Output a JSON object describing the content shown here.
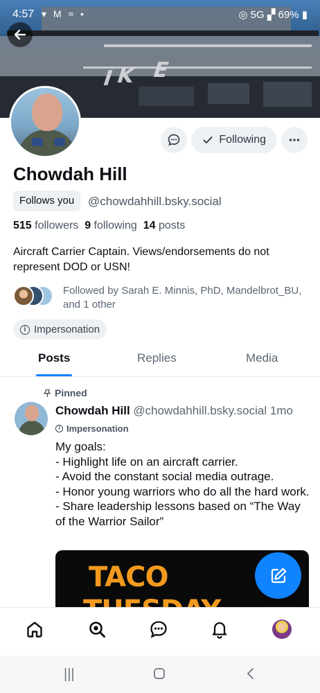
{
  "status_bar": {
    "time": "4:57",
    "left_icons": "▾ M ≈ •",
    "network": "5G",
    "battery": "69%"
  },
  "banner": {
    "letters": [
      "I",
      "K",
      "E"
    ]
  },
  "profile": {
    "display_name": "Chowdah Hill",
    "follows_you": "Follows you",
    "handle": "@chowdahhill.bsky.social",
    "followers_count": "515",
    "followers_label": "followers",
    "following_count": "9",
    "following_label": "following",
    "posts_count": "14",
    "posts_label": "posts",
    "bio": "Aircraft Carrier Captain. Views/endorsements do not represent DOD or USN!",
    "followed_by": "Followed by Sarah E. Minnis, PhD, Mandelbrot_BU, and 1 other",
    "label": "Impersonation"
  },
  "actions": {
    "following_label": "Following"
  },
  "tabs": [
    {
      "label": "Posts",
      "active": true
    },
    {
      "label": "Replies",
      "active": false
    },
    {
      "label": "Media",
      "active": false
    }
  ],
  "post": {
    "pinned_label": "Pinned",
    "author_name": "Chowdah Hill",
    "author_handle": "@chowdahhill.bsky.social",
    "age": "1mo",
    "label": "Impersonation",
    "text": "My goals:\n- Highlight life on an aircraft carrier.\n- Avoid the constant social media outrage.\n- Honor young warriors who do all the hard work.\n- Share leadership lessons based on “The Way of the Warrior Sailor”",
    "image_line1": "TACO",
    "image_line2": "TUESDAY"
  },
  "bottom_nav": [
    "home-icon",
    "search-icon",
    "chat-icon",
    "bell-icon",
    "profile-avatar"
  ],
  "colors": {
    "accent": "#1083fe",
    "pill_bg": "#eef1f4",
    "muted_text": "#5b6673"
  }
}
